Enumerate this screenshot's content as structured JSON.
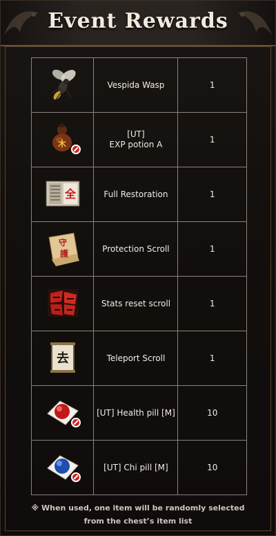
{
  "header": {
    "title": "Event Rewards"
  },
  "rewards": [
    {
      "name": "Vespida Wasp",
      "qty": "1",
      "icon": "wasp-icon"
    },
    {
      "name": "[UT]\nEXP potion A",
      "qty": "1",
      "icon": "exp-potion-icon"
    },
    {
      "name": "Full Restoration",
      "qty": "1",
      "icon": "restoration-book-icon"
    },
    {
      "name": "Protection Scroll",
      "qty": "1",
      "icon": "protection-scroll-icon"
    },
    {
      "name": "Stats reset scroll",
      "qty": "1",
      "icon": "stats-reset-scroll-icon"
    },
    {
      "name": "Teleport Scroll",
      "qty": "1",
      "icon": "teleport-scroll-icon"
    },
    {
      "name": "[UT] Health pill [M]",
      "qty": "10",
      "icon": "health-pill-icon"
    },
    {
      "name": "[UT] Chi pill [M]",
      "qty": "10",
      "icon": "chi-pill-icon"
    }
  ],
  "footer": {
    "line1": "※ When used, one item will be randomly selected",
    "line2": "from the chest’s item list"
  },
  "colors": {
    "accent_border": "#8a847e",
    "background": "#120f0d",
    "text": "#f2ede6"
  }
}
